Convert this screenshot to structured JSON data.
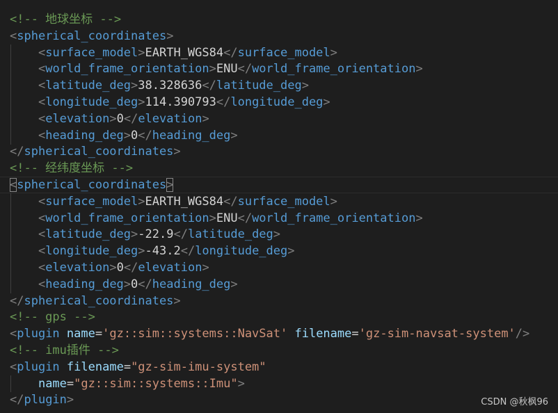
{
  "editor": {
    "lines": [
      {
        "indent": 0,
        "tokens": [
          {
            "t": "comment",
            "v": "<!-- 地球坐标 -->"
          }
        ]
      },
      {
        "indent": 0,
        "tokens": [
          {
            "t": "punc",
            "v": "<"
          },
          {
            "t": "tag",
            "v": "spherical_coordinates"
          },
          {
            "t": "punc",
            "v": ">"
          }
        ]
      },
      {
        "indent": 1,
        "tokens": [
          {
            "t": "punc",
            "v": "<"
          },
          {
            "t": "tag",
            "v": "surface_model"
          },
          {
            "t": "punc",
            "v": ">"
          },
          {
            "t": "text",
            "v": "EARTH_WGS84"
          },
          {
            "t": "punc",
            "v": "</"
          },
          {
            "t": "tag",
            "v": "surface_model"
          },
          {
            "t": "punc",
            "v": ">"
          }
        ]
      },
      {
        "indent": 1,
        "tokens": [
          {
            "t": "punc",
            "v": "<"
          },
          {
            "t": "tag",
            "v": "world_frame_orientation"
          },
          {
            "t": "punc",
            "v": ">"
          },
          {
            "t": "text",
            "v": "ENU"
          },
          {
            "t": "punc",
            "v": "</"
          },
          {
            "t": "tag",
            "v": "world_frame_orientation"
          },
          {
            "t": "punc",
            "v": ">"
          }
        ]
      },
      {
        "indent": 1,
        "tokens": [
          {
            "t": "punc",
            "v": "<"
          },
          {
            "t": "tag",
            "v": "latitude_deg"
          },
          {
            "t": "punc",
            "v": ">"
          },
          {
            "t": "text",
            "v": "38.328636"
          },
          {
            "t": "punc",
            "v": "</"
          },
          {
            "t": "tag",
            "v": "latitude_deg"
          },
          {
            "t": "punc",
            "v": ">"
          }
        ]
      },
      {
        "indent": 1,
        "tokens": [
          {
            "t": "punc",
            "v": "<"
          },
          {
            "t": "tag",
            "v": "longitude_deg"
          },
          {
            "t": "punc",
            "v": ">"
          },
          {
            "t": "text",
            "v": "114.390793"
          },
          {
            "t": "punc",
            "v": "</"
          },
          {
            "t": "tag",
            "v": "longitude_deg"
          },
          {
            "t": "punc",
            "v": ">"
          }
        ]
      },
      {
        "indent": 1,
        "tokens": [
          {
            "t": "punc",
            "v": "<"
          },
          {
            "t": "tag",
            "v": "elevation"
          },
          {
            "t": "punc",
            "v": ">"
          },
          {
            "t": "text",
            "v": "0"
          },
          {
            "t": "punc",
            "v": "</"
          },
          {
            "t": "tag",
            "v": "elevation"
          },
          {
            "t": "punc",
            "v": ">"
          }
        ]
      },
      {
        "indent": 1,
        "tokens": [
          {
            "t": "punc",
            "v": "<"
          },
          {
            "t": "tag",
            "v": "heading_deg"
          },
          {
            "t": "punc",
            "v": ">"
          },
          {
            "t": "text",
            "v": "0"
          },
          {
            "t": "punc",
            "v": "</"
          },
          {
            "t": "tag",
            "v": "heading_deg"
          },
          {
            "t": "punc",
            "v": ">"
          }
        ]
      },
      {
        "indent": 0,
        "tokens": [
          {
            "t": "punc",
            "v": "</"
          },
          {
            "t": "tag",
            "v": "spherical_coordinates"
          },
          {
            "t": "punc",
            "v": ">"
          }
        ]
      },
      {
        "indent": 0,
        "tokens": [
          {
            "t": "comment",
            "v": "<!-- 经纬度坐标 -->"
          }
        ]
      },
      {
        "indent": 0,
        "cursor": true,
        "tokens": [
          {
            "t": "punc",
            "v": "<",
            "match": true
          },
          {
            "t": "tag",
            "v": "spherical_coordinates"
          },
          {
            "t": "punc",
            "v": ">",
            "match": true
          }
        ]
      },
      {
        "indent": 1,
        "tokens": [
          {
            "t": "punc",
            "v": "<"
          },
          {
            "t": "tag",
            "v": "surface_model"
          },
          {
            "t": "punc",
            "v": ">"
          },
          {
            "t": "text",
            "v": "EARTH_WGS84"
          },
          {
            "t": "punc",
            "v": "</"
          },
          {
            "t": "tag",
            "v": "surface_model"
          },
          {
            "t": "punc",
            "v": ">"
          }
        ]
      },
      {
        "indent": 1,
        "tokens": [
          {
            "t": "punc",
            "v": "<"
          },
          {
            "t": "tag",
            "v": "world_frame_orientation"
          },
          {
            "t": "punc",
            "v": ">"
          },
          {
            "t": "text",
            "v": "ENU"
          },
          {
            "t": "punc",
            "v": "</"
          },
          {
            "t": "tag",
            "v": "world_frame_orientation"
          },
          {
            "t": "punc",
            "v": ">"
          }
        ]
      },
      {
        "indent": 1,
        "tokens": [
          {
            "t": "punc",
            "v": "<"
          },
          {
            "t": "tag",
            "v": "latitude_deg"
          },
          {
            "t": "punc",
            "v": ">"
          },
          {
            "t": "text",
            "v": "-22.9"
          },
          {
            "t": "punc",
            "v": "</"
          },
          {
            "t": "tag",
            "v": "latitude_deg"
          },
          {
            "t": "punc",
            "v": ">"
          }
        ]
      },
      {
        "indent": 1,
        "tokens": [
          {
            "t": "punc",
            "v": "<"
          },
          {
            "t": "tag",
            "v": "longitude_deg"
          },
          {
            "t": "punc",
            "v": ">"
          },
          {
            "t": "text",
            "v": "-43.2"
          },
          {
            "t": "punc",
            "v": "</"
          },
          {
            "t": "tag",
            "v": "longitude_deg"
          },
          {
            "t": "punc",
            "v": ">"
          }
        ]
      },
      {
        "indent": 1,
        "tokens": [
          {
            "t": "punc",
            "v": "<"
          },
          {
            "t": "tag",
            "v": "elevation"
          },
          {
            "t": "punc",
            "v": ">"
          },
          {
            "t": "text",
            "v": "0"
          },
          {
            "t": "punc",
            "v": "</"
          },
          {
            "t": "tag",
            "v": "elevation"
          },
          {
            "t": "punc",
            "v": ">"
          }
        ]
      },
      {
        "indent": 1,
        "tokens": [
          {
            "t": "punc",
            "v": "<"
          },
          {
            "t": "tag",
            "v": "heading_deg"
          },
          {
            "t": "punc",
            "v": ">"
          },
          {
            "t": "text",
            "v": "0"
          },
          {
            "t": "punc",
            "v": "</"
          },
          {
            "t": "tag",
            "v": "heading_deg"
          },
          {
            "t": "punc",
            "v": ">"
          }
        ]
      },
      {
        "indent": 0,
        "tokens": [
          {
            "t": "punc",
            "v": "</"
          },
          {
            "t": "tag",
            "v": "spherical_coordinates"
          },
          {
            "t": "punc",
            "v": ">"
          }
        ]
      },
      {
        "indent": 0,
        "tokens": [
          {
            "t": "comment",
            "v": "<!-- gps -->"
          }
        ]
      },
      {
        "indent": 0,
        "tokens": [
          {
            "t": "punc",
            "v": "<"
          },
          {
            "t": "tag",
            "v": "plugin"
          },
          {
            "t": "text",
            "v": " "
          },
          {
            "t": "attr",
            "v": "name"
          },
          {
            "t": "eq",
            "v": "="
          },
          {
            "t": "str",
            "v": "'gz::sim::systems::NavSat'"
          },
          {
            "t": "text",
            "v": " "
          },
          {
            "t": "attr",
            "v": "filename"
          },
          {
            "t": "eq",
            "v": "="
          },
          {
            "t": "str",
            "v": "'gz-sim-navsat-system'"
          },
          {
            "t": "punc",
            "v": "/>"
          }
        ]
      },
      {
        "indent": 0,
        "tokens": [
          {
            "t": "comment",
            "v": "<!-- imu插件 -->"
          }
        ]
      },
      {
        "indent": 0,
        "tokens": [
          {
            "t": "punc",
            "v": "<"
          },
          {
            "t": "tag",
            "v": "plugin"
          },
          {
            "t": "text",
            "v": " "
          },
          {
            "t": "attr",
            "v": "filename"
          },
          {
            "t": "eq",
            "v": "="
          },
          {
            "t": "str",
            "v": "\"gz-sim-imu-system\""
          }
        ]
      },
      {
        "indent": 1,
        "tokens": [
          {
            "t": "attr",
            "v": "name"
          },
          {
            "t": "eq",
            "v": "="
          },
          {
            "t": "str",
            "v": "\"gz::sim::systems::Imu\""
          },
          {
            "t": "punc",
            "v": ">"
          }
        ]
      },
      {
        "indent": 0,
        "tokens": [
          {
            "t": "punc",
            "v": "</"
          },
          {
            "t": "tag",
            "v": "plugin"
          },
          {
            "t": "punc",
            "v": ">"
          }
        ]
      }
    ]
  },
  "watermark": "CSDN @秋枫96",
  "colors": {
    "background": "#1e1e1e",
    "comment": "#6a9955",
    "punctuation": "#808080",
    "tag": "#569cd6",
    "text": "#d4d4d4",
    "attribute": "#9cdcfe",
    "string": "#ce9178"
  }
}
